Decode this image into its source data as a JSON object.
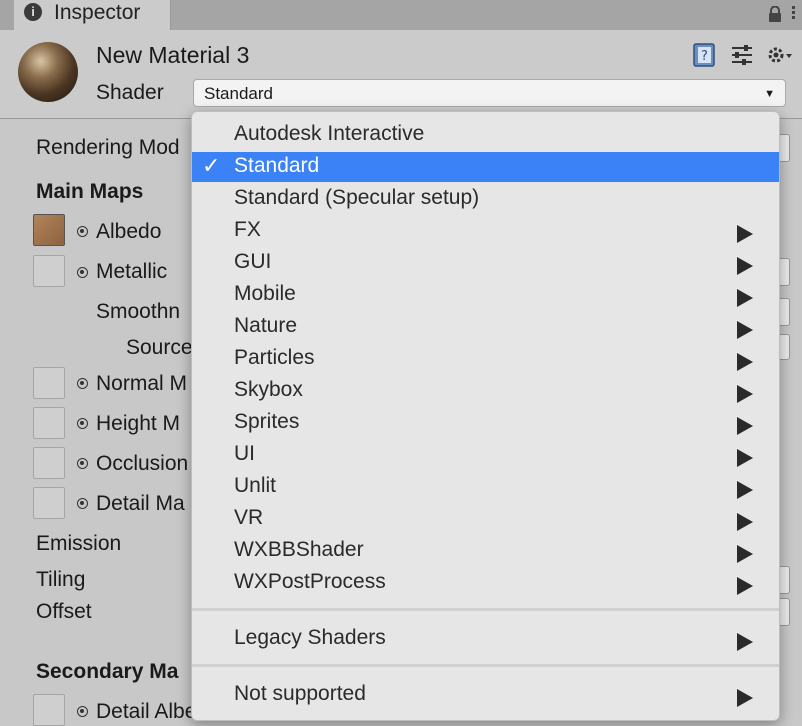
{
  "tab": {
    "title": "Inspector",
    "info_icon": "i"
  },
  "material": {
    "name": "New Material 3",
    "shader_label": "Shader",
    "shader_value": "Standard"
  },
  "properties": {
    "rendering_mode": "Rendering Mod",
    "main_maps": "Main Maps",
    "albedo": "Albedo",
    "metallic": "Metallic",
    "smoothness": "Smoothn",
    "source": "Source",
    "normal_map": "Normal M",
    "height_map": "Height M",
    "occlusion": "Occlusion",
    "detail_mask": "Detail Ma",
    "emission": "Emission",
    "tiling": "Tiling",
    "offset": "Offset",
    "secondary_maps": "Secondary Ma",
    "detail_albedo": "Detail Albedo"
  },
  "menu": {
    "items": [
      {
        "label": "Autodesk Interactive",
        "submenu": false,
        "selected": false
      },
      {
        "label": "Standard",
        "submenu": false,
        "selected": true
      },
      {
        "label": "Standard (Specular setup)",
        "submenu": false,
        "selected": false
      },
      {
        "label": "FX",
        "submenu": true,
        "selected": false
      },
      {
        "label": "GUI",
        "submenu": true,
        "selected": false
      },
      {
        "label": "Mobile",
        "submenu": true,
        "selected": false
      },
      {
        "label": "Nature",
        "submenu": true,
        "selected": false
      },
      {
        "label": "Particles",
        "submenu": true,
        "selected": false
      },
      {
        "label": "Skybox",
        "submenu": true,
        "selected": false
      },
      {
        "label": "Sprites",
        "submenu": true,
        "selected": false
      },
      {
        "label": "UI",
        "submenu": true,
        "selected": false
      },
      {
        "label": "Unlit",
        "submenu": true,
        "selected": false
      },
      {
        "label": "VR",
        "submenu": true,
        "selected": false
      },
      {
        "label": "WXBBShader",
        "submenu": true,
        "selected": false
      },
      {
        "label": "WXPostProcess",
        "submenu": true,
        "selected": false
      }
    ],
    "legacy": {
      "label": "Legacy Shaders",
      "submenu": true
    },
    "not_supported": {
      "label": "Not supported",
      "submenu": true
    },
    "check_glyph": "✓"
  },
  "colors": {
    "selection": "#3b82f6",
    "menu_bg": "#e6e6e6",
    "panel_bg": "#c8c8c8"
  }
}
